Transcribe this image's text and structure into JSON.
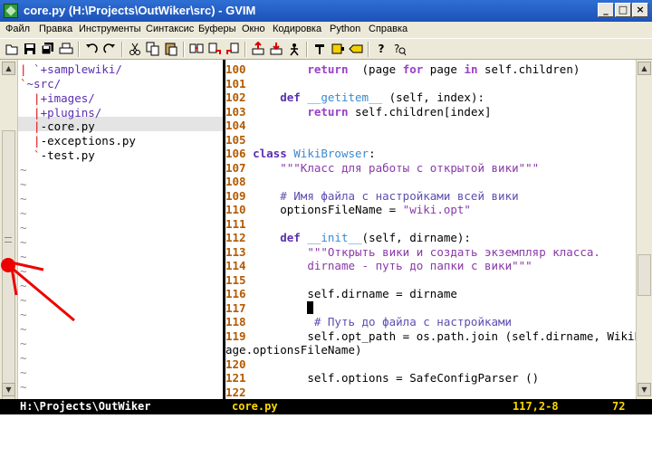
{
  "window": {
    "title": "core.py (H:\\Projects\\OutWiker\\src) - GVIM",
    "minimize": "_",
    "maximize": "□",
    "close": "×"
  },
  "menu": [
    "Файл",
    "Правка",
    "Инструменты",
    "Синтаксис",
    "Буферы",
    "Окно",
    "Кодировка",
    "Python",
    "Справка"
  ],
  "toolbar_icons": [
    "open-icon",
    "save-icon",
    "save-all-icon",
    "print-icon",
    "undo-icon",
    "redo-icon",
    "cut-icon",
    "copy-icon",
    "paste-icon",
    "find-replace-icon",
    "find-next-icon",
    "find-prev-icon",
    "load-session-icon",
    "save-session-icon",
    "run-script-icon",
    "make-icon",
    "shell-icon",
    "tags-icon",
    "help-icon",
    "find-help-icon"
  ],
  "file_tree": [
    {
      "prefix": "|",
      "text": " `+samplewiki/",
      "hl": false
    },
    {
      "prefix": "`",
      "text": "~src/",
      "hl": false
    },
    {
      "prefix": "  |",
      "text": "+images/",
      "hl": false
    },
    {
      "prefix": "  |",
      "text": "+plugins/",
      "hl": false
    },
    {
      "prefix": "  |",
      "text": "-core.py",
      "hl": true
    },
    {
      "prefix": "  |",
      "text": "-exceptions.py",
      "hl": false
    },
    {
      "prefix": "  `",
      "text": "-test.py",
      "hl": false
    }
  ],
  "tilde": "~",
  "code": {
    "l100": {
      "num": "100",
      "pre": "        ",
      "kw": "return",
      "rest": "  (page ",
      "kw2": "for",
      "rest2": " page ",
      "kw3": "in",
      "rest3": " self.children)"
    },
    "l101": {
      "num": "101"
    },
    "l102": {
      "num": "102",
      "pre": "    ",
      "kw": "def",
      "fn": "__getitem__",
      "rest": " (self, index):"
    },
    "l103": {
      "num": "103",
      "pre": "        ",
      "kw": "return",
      "rest": " self.children[index]"
    },
    "l104": {
      "num": "104"
    },
    "l105": {
      "num": "105"
    },
    "l106": {
      "num": "106",
      "kw": "class",
      "cls": "WikiBrowser",
      "rest": ":"
    },
    "l107": {
      "num": "107",
      "pre": "    ",
      "str": "\"\"\"Класс для работы с открытой вики\"\"\""
    },
    "l108": {
      "num": "108"
    },
    "l109": {
      "num": "109",
      "pre": "    ",
      "cmt": "# Имя файла с настройками всей вики"
    },
    "l110": {
      "num": "110",
      "pre": "    ",
      "rest": "optionsFileName = ",
      "str": "\"wiki.opt\""
    },
    "l111": {
      "num": "111"
    },
    "l112": {
      "num": "112",
      "pre": "    ",
      "kw": "def",
      "fn": "__init__",
      "rest": "(self, dirname):"
    },
    "l113": {
      "num": "113",
      "pre": "        ",
      "str": "\"\"\"Открыть вики и создать экземпляр класса."
    },
    "l114": {
      "num": "114",
      "pre": "        ",
      "str": "dirname - путь до папки с вики\"\"\""
    },
    "l115": {
      "num": "115"
    },
    "l116": {
      "num": "116",
      "pre": "        ",
      "rest": "self.dirname = dirname"
    },
    "l117": {
      "num": "117",
      "pre": "        "
    },
    "l118": {
      "num": "118",
      "pre": "         ",
      "cmt": "# Путь до файла с настройками"
    },
    "l119": {
      "num": "119",
      "pre": "        ",
      "rest": "self.opt_path = os.path.join (self.dirname, WikiP"
    },
    "l119b": {
      "rest": "age.optionsFileName)"
    },
    "l120": {
      "num": "120"
    },
    "l121": {
      "num": "121",
      "pre": "        ",
      "rest": "self.options = SafeConfigParser ()"
    },
    "l122": {
      "num": "122"
    }
  },
  "status": {
    "left_path": "H:\\Projects\\OutWiker",
    "file": "core.py",
    "position": "117,2-8",
    "percent": "72"
  },
  "colors": {
    "annotation": "#ee0000",
    "line_number": "#b45a00",
    "status_text": "#ffd700"
  }
}
